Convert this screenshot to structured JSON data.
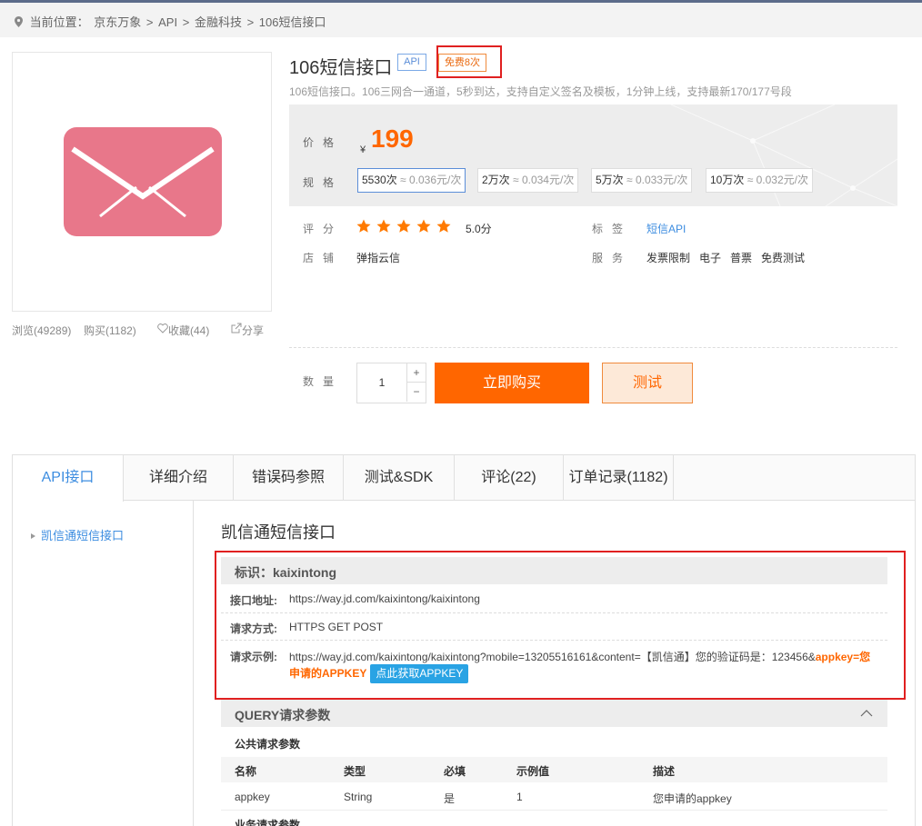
{
  "breadcrumb": {
    "prefix": "当前位置：",
    "items": [
      "京东万象",
      "API",
      "金融科技",
      "106短信接口"
    ],
    "sep": ">"
  },
  "stats": {
    "views": "浏览(49289)",
    "buys": "购买(1182)",
    "fav": "收藏(44)",
    "share": "分享"
  },
  "product": {
    "title": "106短信接口",
    "api_tag": "API",
    "free_tag": "免费8次",
    "desc": "106短信接口。106三网合一通道，5秒到达，支持自定义签名及模板，1分钟上线，支持最新170/177号段"
  },
  "price": {
    "label": "价格",
    "currency": "¥",
    "value": "199",
    "spec_label": "规格"
  },
  "specs": [
    {
      "name": "5530次",
      "unit": "≈ 0.036元/次"
    },
    {
      "name": "2万次",
      "unit": "≈ 0.034元/次"
    },
    {
      "name": "5万次",
      "unit": "≈ 0.033元/次"
    },
    {
      "name": "10万次",
      "unit": "≈ 0.032元/次"
    }
  ],
  "info": {
    "rating_label": "评分",
    "rating": 5,
    "score": "5.0分",
    "tag_label": "标签",
    "tag": "短信API",
    "shop_label": "店铺",
    "shop": "弹指云信",
    "service_label": "服务",
    "services": [
      "发票限制",
      "电子",
      "普票",
      "免费测试"
    ]
  },
  "purchase": {
    "qty_label": "数量",
    "qty": "1",
    "plus": "+",
    "minus": "−",
    "buy": "立即购买",
    "test": "测试"
  },
  "tabs": [
    "API接口",
    "详细介绍",
    "错误码参照",
    "测试&SDK",
    "评论(22)",
    "订单记录(1182)"
  ],
  "sidebar": {
    "items": [
      "凯信通短信接口"
    ]
  },
  "api": {
    "title": "凯信通短信接口",
    "id_label": "标识：",
    "id": "kaixintong",
    "addr_label": "接口地址:",
    "addr": "https://way.jd.com/kaixintong/kaixintong",
    "method_label": "请求方式:",
    "method": "HTTPS GET POST",
    "example_label": "请求示例:",
    "example_plain": "https://way.jd.com/kaixintong/kaixintong?mobile=13205516161&content=【凯信通】您的验证码是：123456&",
    "example_hl1": "appkey=您",
    "example_hl2": "申请的APPKEY",
    "get_key": "点此获取APPKEY"
  },
  "query": {
    "title": "QUERY请求参数",
    "public_title": "公共请求参数",
    "headers": [
      "名称",
      "类型",
      "必填",
      "示例值",
      "描述"
    ],
    "rows": [
      [
        "appkey",
        "String",
        "是",
        "1",
        "您申请的appkey"
      ]
    ],
    "biz_title": "业务请求参数"
  },
  "colors": {
    "accent": "#ff6600",
    "link": "#3d8de0",
    "highlight_box": "#e02020",
    "envelope": "#e8778a"
  }
}
